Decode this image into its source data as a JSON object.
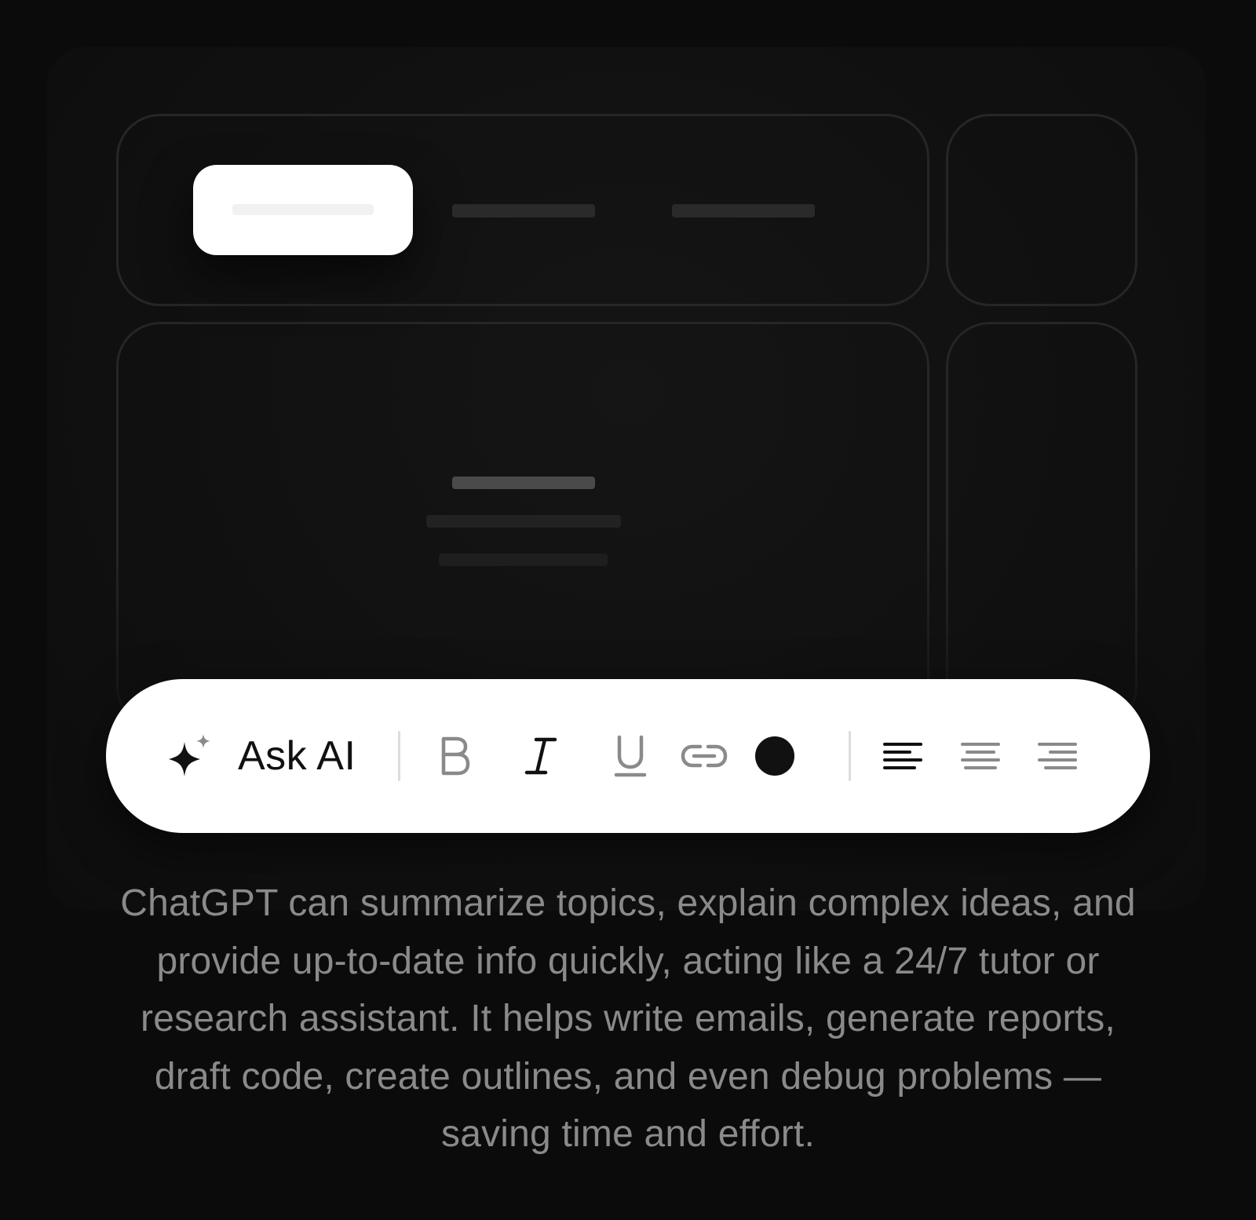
{
  "toolbar": {
    "ask_ai_label": "Ask AI",
    "icons": [
      "sparkle-icon",
      "bold-icon",
      "italic-icon",
      "underline-icon",
      "link-icon",
      "text-color-icon",
      "align-left-icon",
      "align-center-icon",
      "align-right-icon"
    ],
    "active_alignment": "left",
    "text_color": "#111111"
  },
  "description": "ChatGPT can summarize topics, explain complex ideas, and provide up-to-date info quickly, acting like a 24/7 tutor or research assistant. It helps write emails, generate reports, draft code, create outlines, and even debug problems — saving time and effort.",
  "colors": {
    "background": "#0b0b0b",
    "toolbar_background": "#ffffff",
    "description_text": "#8a8a8a",
    "card_border": "#262626"
  }
}
